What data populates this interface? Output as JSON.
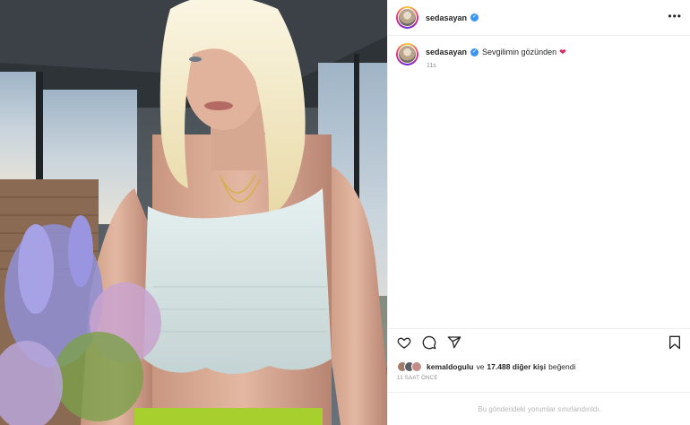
{
  "post": {
    "username": "sedasayan",
    "verified": true,
    "caption": "Sevgilimin gözünden",
    "caption_emoji": "❤",
    "time_ago": "11s",
    "liked_by_user": "kemaldogulu",
    "likes_connector": "ve",
    "likes_others": "17.488 diğer kişi",
    "likes_suffix": "beğendi",
    "timestamp": "11 SAAT ÖNCE",
    "comments_disabled_text": "Bu gönderideki yorumlar sınırlandırıldı."
  },
  "icons": {
    "more": "more-options-icon",
    "like": "heart-icon",
    "comment": "comment-icon",
    "share": "share-icon",
    "save": "bookmark-icon",
    "verified": "verified-badge-icon"
  },
  "colors": {
    "verified_blue": "#3897f0",
    "heart_red": "#e0245e",
    "muted_text": "#8e8e8e"
  }
}
